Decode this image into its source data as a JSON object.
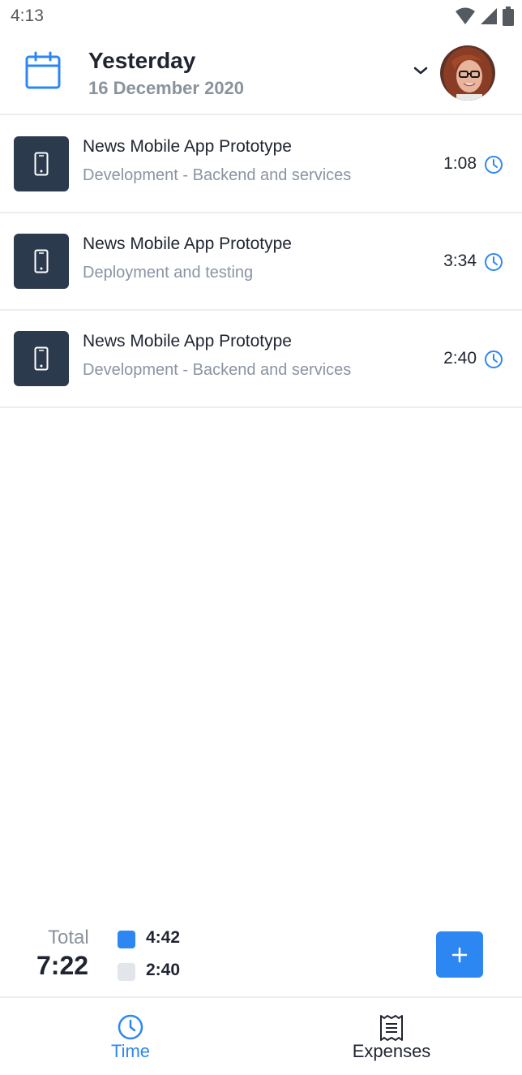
{
  "status_bar": {
    "time": "4:13",
    "icons": [
      "wifi-icon",
      "signal-icon",
      "battery-icon"
    ]
  },
  "header": {
    "title": "Yesterday",
    "date": "16 December 2020",
    "icons": [
      "calendar-icon",
      "chevron-down-icon"
    ]
  },
  "entries": [
    {
      "title": "News Mobile App Prototype",
      "subtitle": "Development - Backend and services",
      "duration": "1:08",
      "icon": "mobile-phone-icon"
    },
    {
      "title": "News Mobile App Prototype",
      "subtitle": "Deployment and testing",
      "duration": "3:34",
      "icon": "mobile-phone-icon"
    },
    {
      "title": "News Mobile App Prototype",
      "subtitle": "Development - Backend and services",
      "duration": "2:40",
      "icon": "mobile-phone-icon"
    }
  ],
  "totals": {
    "label": "Total",
    "value": "7:22",
    "legend": [
      {
        "value": "4:42",
        "color": "#2d87f3"
      },
      {
        "value": "2:40",
        "color": "#e2e5ea"
      }
    ]
  },
  "bottom_nav": {
    "items": [
      {
        "label": "Time",
        "icon": "clock-icon",
        "active": true
      },
      {
        "label": "Expenses",
        "icon": "receipt-icon",
        "active": false
      }
    ]
  },
  "colors": {
    "accent": "#2d87f3",
    "thumb_bg": "#2c3a4e",
    "muted_text": "#8a929c",
    "divider": "#eceef0"
  }
}
